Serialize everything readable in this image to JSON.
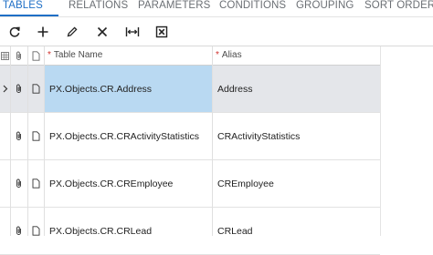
{
  "tabs": [
    {
      "label": "TABLES",
      "active": true
    },
    {
      "label": "RELATIONS",
      "active": false
    },
    {
      "label": "PARAMETERS",
      "active": false
    },
    {
      "label": "CONDITIONS",
      "active": false
    },
    {
      "label": "GROUPING",
      "active": false
    },
    {
      "label": "SORT ORDER",
      "active": false
    }
  ],
  "toolbar": [
    {
      "icon": "refresh-icon",
      "action": "refresh"
    },
    {
      "icon": "plus-icon",
      "action": "add"
    },
    {
      "icon": "pencil-icon",
      "action": "edit"
    },
    {
      "icon": "close-icon",
      "action": "delete"
    },
    {
      "icon": "fit-width-icon",
      "action": "fit-to-screen"
    },
    {
      "icon": "excel-icon",
      "action": "export-to-excel"
    }
  ],
  "grid": {
    "columns": {
      "table_name": {
        "label": "Table Name",
        "required": true
      },
      "alias": {
        "label": "Alias",
        "required": true
      }
    },
    "rows": [
      {
        "table_name": "PX.Objects.CR.Address",
        "alias": "Address",
        "selected": true
      },
      {
        "table_name": "PX.Objects.CR.CRActivityStatistics",
        "alias": "CRActivityStatistics",
        "selected": false
      },
      {
        "table_name": "PX.Objects.CR.CREmployee",
        "alias": "CREmployee",
        "selected": false
      },
      {
        "table_name": "PX.Objects.CR.CRLead",
        "alias": "CRLead",
        "selected": false
      }
    ]
  },
  "colors": {
    "accent": "#1f6fc6",
    "selected_row": "#e4e6ea",
    "active_cell": "#b9d9f2",
    "required_marker": "#d0312d"
  }
}
